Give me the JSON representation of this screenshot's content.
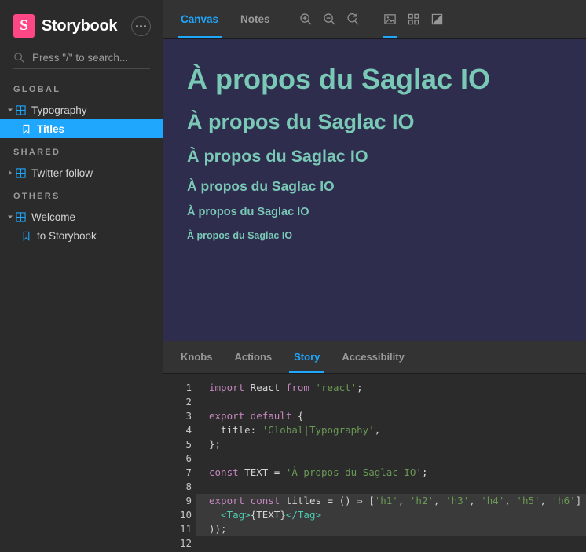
{
  "sidebar": {
    "brand": {
      "logo_letter": "S",
      "name": "Storybook"
    },
    "menu_button": "menu-dots",
    "search": {
      "placeholder": "Press \"/\" to search...",
      "value": ""
    },
    "sections": [
      {
        "label": "GLOBAL",
        "nodes": [
          {
            "label": "Typography",
            "type": "component",
            "expanded": true,
            "selected": false,
            "depth": 0
          },
          {
            "label": "Titles",
            "type": "story",
            "expanded": false,
            "selected": true,
            "depth": 1
          }
        ]
      },
      {
        "label": "SHARED",
        "nodes": [
          {
            "label": "Twitter follow",
            "type": "component",
            "expanded": false,
            "selected": false,
            "depth": 0
          }
        ]
      },
      {
        "label": "OTHERS",
        "nodes": [
          {
            "label": "Welcome",
            "type": "component",
            "expanded": true,
            "selected": false,
            "depth": 0
          },
          {
            "label": "to Storybook",
            "type": "story",
            "expanded": false,
            "selected": false,
            "depth": 1
          }
        ]
      }
    ]
  },
  "toolbar": {
    "tabs": [
      {
        "label": "Canvas",
        "active": true
      },
      {
        "label": "Notes",
        "active": false
      }
    ],
    "buttons": [
      {
        "name": "zoom-in-icon",
        "active": false
      },
      {
        "name": "zoom-out-icon",
        "active": false
      },
      {
        "name": "zoom-reset-icon",
        "active": false
      },
      {
        "name": "background-image-icon",
        "active": true
      },
      {
        "name": "grid-icon",
        "active": false
      },
      {
        "name": "contrast-icon",
        "active": false
      }
    ]
  },
  "preview": {
    "background_color": "#2e2d4d",
    "text_color": "#7ac8b6",
    "headings": [
      {
        "tag": "h1",
        "text": "À propos du Saglac IO"
      },
      {
        "tag": "h2",
        "text": "À propos du Saglac IO"
      },
      {
        "tag": "h3",
        "text": "À propos du Saglac IO"
      },
      {
        "tag": "h4",
        "text": "À propos du Saglac IO"
      },
      {
        "tag": "h5",
        "text": "À propos du Saglac IO"
      },
      {
        "tag": "h6",
        "text": "À propos du Saglac IO"
      }
    ]
  },
  "panel": {
    "tabs": [
      {
        "label": "Knobs",
        "active": false
      },
      {
        "label": "Actions",
        "active": false
      },
      {
        "label": "Story",
        "active": true
      },
      {
        "label": "Accessibility",
        "active": false
      }
    ],
    "code": {
      "accent_color": "#1ea7fd",
      "lines": [
        {
          "n": "1",
          "highlight": false
        },
        {
          "n": "2",
          "highlight": false
        },
        {
          "n": "3",
          "highlight": false
        },
        {
          "n": "4",
          "highlight": false
        },
        {
          "n": "5",
          "highlight": false
        },
        {
          "n": "6",
          "highlight": false
        },
        {
          "n": "7",
          "highlight": false
        },
        {
          "n": "8",
          "highlight": false
        },
        {
          "n": "9",
          "highlight": true
        },
        {
          "n": "10",
          "highlight": true
        },
        {
          "n": "11",
          "highlight": true
        },
        {
          "n": "12",
          "highlight": false
        }
      ],
      "text": {
        "l1_import": "import",
        "l1_react": " React ",
        "l1_from": "from",
        "l1_module": " 'react'",
        "l1_semi": ";",
        "l3_export": "export",
        "l3_default": " default",
        "l3_brace": " {",
        "l4_title": "  title: ",
        "l4_value": "'Global|Typography'",
        "l4_comma": ",",
        "l5_close": "};",
        "l7_const": "const",
        "l7_name": " TEXT = ",
        "l7_value": "'À propos du Saglac IO'",
        "l7_semi": ";",
        "l9_export": "export const",
        "l9_mid": " titles = () ⇒ [",
        "l9_arr1": "'h1'",
        "l9_c1": ", ",
        "l9_arr2": "'h2'",
        "l9_c2": ", ",
        "l9_arr3": "'h3'",
        "l9_c3": ", ",
        "l9_arr4": "'h4'",
        "l9_c4": ", ",
        "l9_arr5": "'h5'",
        "l9_c5": ", ",
        "l9_arr6": "'h6'",
        "l9_end": "]",
        "l10_open": "  <Tag>",
        "l10_expr": "{TEXT}",
        "l10_close": "</Tag>",
        "l11_close": "));"
      }
    }
  }
}
